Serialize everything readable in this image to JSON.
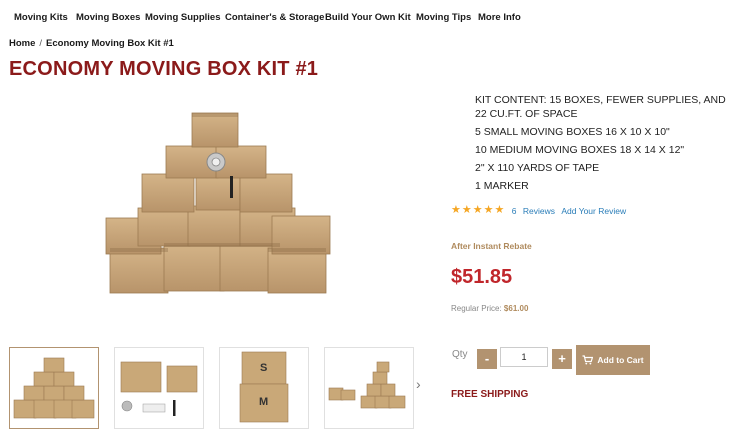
{
  "nav": {
    "items": [
      {
        "label": "Moving Kits"
      },
      {
        "label": "Moving Boxes"
      },
      {
        "label": "Moving Supplies"
      },
      {
        "label": "Container's & Storage"
      },
      {
        "label": "Build Your Own Kit"
      },
      {
        "label": "Moving Tips"
      },
      {
        "label": "More Info"
      }
    ]
  },
  "breadcrumb": {
    "home": "Home",
    "separator": "/",
    "current": "Economy Moving Box Kit #1"
  },
  "product": {
    "title": "ECONOMY MOVING BOX KIT #1",
    "kit_content": [
      "KIT CONTENT: 15 BOXES, FEWER SUPPLIES, AND 22 CU.FT. OF SPACE",
      "5 SMALL MOVING BOXES 16 X 10 X 10\"",
      "10 MEDIUM MOVING BOXES 18 X 14 X 12\"",
      "2\" X 110 YARDS OF TAPE",
      "1 MARKER"
    ],
    "rating": {
      "stars": 5,
      "review_count": "6",
      "reviews_label": "Reviews",
      "add_review_label": "Add Your Review"
    },
    "rebate_label": "After Instant Rebate",
    "price": "$51.85",
    "regular_price_label": "Regular Price:",
    "regular_price": "$61.00",
    "qty_label": "Qty",
    "qty_value": "1",
    "minus_label": "-",
    "plus_label": "+",
    "add_to_cart_label": "Add to Cart",
    "free_shipping": "FREE SHIPPING"
  },
  "thumbnails": {
    "box_labels": [
      "S",
      "M"
    ],
    "next_arrow": "›"
  },
  "colors": {
    "title": "#8b1a1a",
    "price": "#c0262b",
    "accent": "#b29370",
    "link": "#2a7db8",
    "star": "#f5a623",
    "box": "#c9a878"
  },
  "icons": {
    "cart": "cart-icon",
    "star": "star-icon",
    "next": "chevron-right-icon"
  }
}
